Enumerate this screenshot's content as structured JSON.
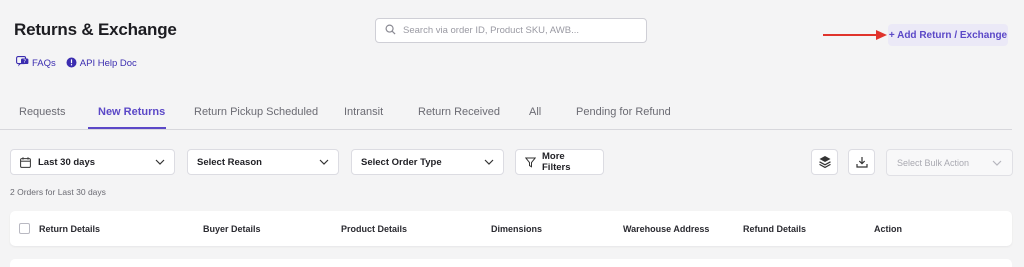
{
  "header": {
    "title": "Returns & Exchange",
    "add_button_label": "+ Add Return / Exchange"
  },
  "search": {
    "placeholder": "Search via order ID, Product SKU, AWB..."
  },
  "help_links": [
    {
      "label": "FAQs",
      "icon": "chat-question-icon"
    },
    {
      "label": "API Help Doc",
      "icon": "info-circle-icon"
    }
  ],
  "tabs": [
    {
      "label": "Requests",
      "active": false
    },
    {
      "label": "New Returns",
      "active": true
    },
    {
      "label": "Return Pickup Scheduled",
      "active": false
    },
    {
      "label": "Intransit",
      "active": false
    },
    {
      "label": "Return Received",
      "active": false
    },
    {
      "label": "All",
      "active": false
    },
    {
      "label": "Pending for Refund",
      "active": false
    }
  ],
  "filters": {
    "date_range": "Last 30 days",
    "reason": "Select Reason",
    "order_type": "Select Order Type",
    "more_filters": "More Filters",
    "bulk_action": "Select Bulk Action"
  },
  "summary": {
    "count_text": "2 Orders for Last 30 days"
  },
  "table": {
    "columns": [
      "Return Details",
      "Buyer Details",
      "Product Details",
      "Dimensions",
      "Warehouse Address",
      "Refund Details",
      "Action"
    ]
  },
  "colors": {
    "accent": "#5b48c7",
    "annotation_arrow": "#e0332c"
  }
}
